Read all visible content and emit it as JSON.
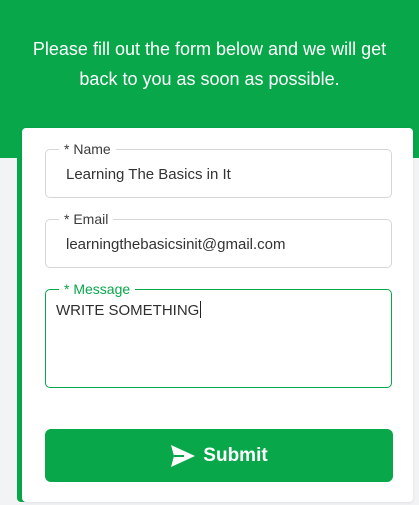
{
  "header": {
    "line1": "Please fill out the form below and we will get",
    "line2": "back to you as soon as possible."
  },
  "form": {
    "name": {
      "label": "* Name",
      "value": "Learning The Basics in It"
    },
    "email": {
      "label": "* Email",
      "value": "learningthebasicsinit@gmail.com"
    },
    "message": {
      "label": "* Message",
      "value": "WRITE SOMETHING"
    },
    "submit": {
      "label": "Submit",
      "icon": "paper-plane-icon"
    }
  },
  "colors": {
    "accent": "#07a74a",
    "text": "#333333",
    "border": "#d6d6d6",
    "background": "#f2f3f5"
  }
}
